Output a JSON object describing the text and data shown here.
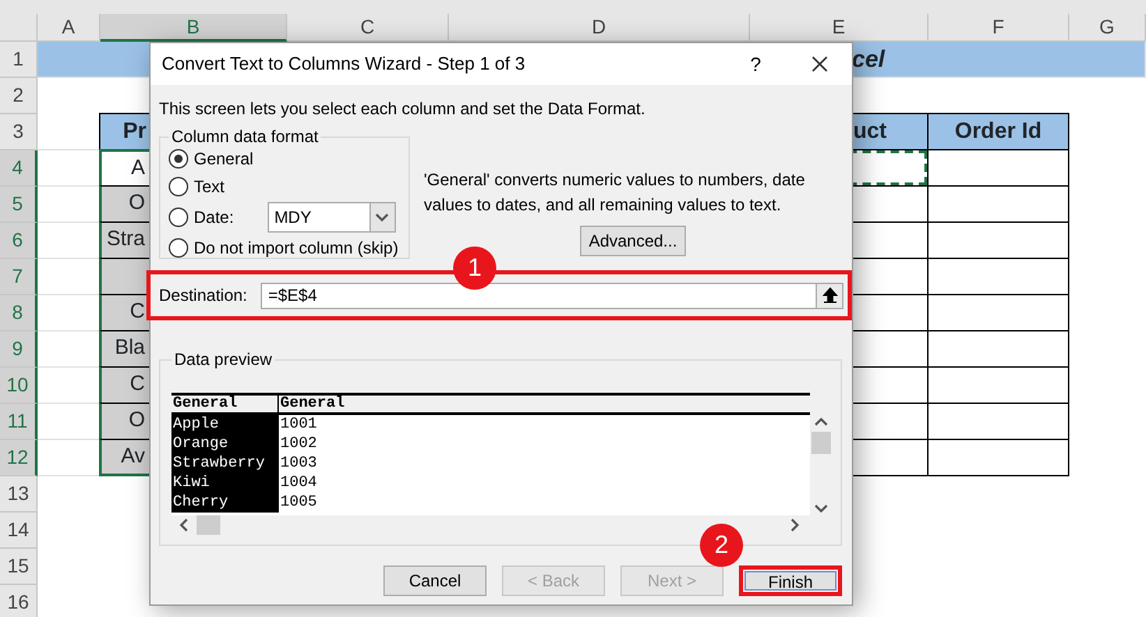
{
  "sheet": {
    "columns": [
      {
        "label": "A",
        "selected": false
      },
      {
        "label": "B",
        "selected": true
      },
      {
        "label": "C",
        "selected": false
      },
      {
        "label": "D",
        "selected": false
      },
      {
        "label": "E",
        "selected": false
      },
      {
        "label": "F",
        "selected": false
      },
      {
        "label": "G",
        "selected": false
      }
    ],
    "rows": [
      {
        "number": "1",
        "selected": false,
        "cells": [
          {
            "kind": "title",
            "text": "cel"
          }
        ]
      },
      {
        "number": "2",
        "selected": false,
        "cells": []
      },
      {
        "number": "3",
        "selected": false,
        "cells": [
          {
            "kind": "blank"
          },
          {
            "kind": "header",
            "text": "Pr"
          },
          {
            "kind": "header"
          },
          {
            "kind": "header"
          },
          {
            "kind": "header",
            "text": "uct"
          },
          {
            "kind": "header",
            "text": "Order Id"
          }
        ]
      },
      {
        "number": "4",
        "selected": true,
        "cells": [
          {
            "kind": "blank"
          },
          {
            "kind": "data",
            "text": "A",
            "selected": true,
            "active": true
          },
          {
            "kind": "data"
          },
          {
            "kind": "data"
          },
          {
            "kind": "data",
            "marquee": true
          },
          {
            "kind": "data"
          }
        ]
      },
      {
        "number": "5",
        "selected": true,
        "cells": [
          {
            "kind": "blank"
          },
          {
            "kind": "data",
            "text": "O",
            "selected": true
          },
          {
            "kind": "data"
          },
          {
            "kind": "data"
          },
          {
            "kind": "data"
          },
          {
            "kind": "data"
          }
        ]
      },
      {
        "number": "6",
        "selected": true,
        "cells": [
          {
            "kind": "blank"
          },
          {
            "kind": "data",
            "text": "Stra",
            "selected": true
          },
          {
            "kind": "data"
          },
          {
            "kind": "data"
          },
          {
            "kind": "data"
          },
          {
            "kind": "data"
          }
        ]
      },
      {
        "number": "7",
        "selected": true,
        "cells": [
          {
            "kind": "blank"
          },
          {
            "kind": "data",
            "selected": true
          },
          {
            "kind": "data"
          },
          {
            "kind": "data"
          },
          {
            "kind": "data"
          },
          {
            "kind": "data"
          }
        ]
      },
      {
        "number": "8",
        "selected": true,
        "cells": [
          {
            "kind": "blank"
          },
          {
            "kind": "data",
            "text": "C",
            "selected": true
          },
          {
            "kind": "data"
          },
          {
            "kind": "data"
          },
          {
            "kind": "data"
          },
          {
            "kind": "data"
          }
        ]
      },
      {
        "number": "9",
        "selected": true,
        "cells": [
          {
            "kind": "blank"
          },
          {
            "kind": "data",
            "text": "Bla",
            "selected": true
          },
          {
            "kind": "data"
          },
          {
            "kind": "data"
          },
          {
            "kind": "data"
          },
          {
            "kind": "data"
          }
        ]
      },
      {
        "number": "10",
        "selected": true,
        "cells": [
          {
            "kind": "blank"
          },
          {
            "kind": "data",
            "text": "C",
            "selected": true
          },
          {
            "kind": "data"
          },
          {
            "kind": "data"
          },
          {
            "kind": "data"
          },
          {
            "kind": "data"
          }
        ]
      },
      {
        "number": "11",
        "selected": true,
        "cells": [
          {
            "kind": "blank"
          },
          {
            "kind": "data",
            "text": "O",
            "selected": true
          },
          {
            "kind": "data"
          },
          {
            "kind": "data"
          },
          {
            "kind": "data"
          },
          {
            "kind": "data"
          }
        ]
      },
      {
        "number": "12",
        "selected": true,
        "cells": [
          {
            "kind": "blank"
          },
          {
            "kind": "data",
            "text": "Av",
            "selected": true
          },
          {
            "kind": "data"
          },
          {
            "kind": "data"
          },
          {
            "kind": "data"
          },
          {
            "kind": "data"
          }
        ]
      },
      {
        "number": "13",
        "selected": false,
        "cells": []
      },
      {
        "number": "14",
        "selected": false,
        "cells": []
      },
      {
        "number": "15",
        "selected": false,
        "cells": []
      },
      {
        "number": "16",
        "selected": false,
        "cells": []
      }
    ]
  },
  "dialog": {
    "title": "Convert Text to Columns Wizard - Step 1 of 3",
    "help": "?",
    "intro": "This screen lets you select each column and set the Data Format.",
    "format_group": {
      "title": "Column data format",
      "options": [
        {
          "kind": "plain",
          "label": "General",
          "selected": true
        },
        {
          "kind": "plain",
          "label": "Text",
          "selected": false
        },
        {
          "kind": "date",
          "label": "Date:",
          "selected": false,
          "dropdown": "MDY"
        },
        {
          "kind": "plain",
          "label": "Do not import column (skip)",
          "selected": false
        }
      ]
    },
    "description": "'General' converts numeric values to numbers, date values to dates, and all remaining values to text.",
    "advanced_button": "Advanced...",
    "destination": {
      "label": "Destination:",
      "value": "=$E$4",
      "highlighted": true
    },
    "preview": {
      "title": "Data preview",
      "columns": [
        {
          "header": "General",
          "selected": true
        },
        {
          "header": "General",
          "selected": false
        }
      ],
      "rows": [
        [
          "Apple",
          "1001"
        ],
        [
          "Orange",
          "1002"
        ],
        [
          "Strawberry",
          "1003"
        ],
        [
          "Kiwi",
          "1004"
        ],
        [
          "Cherry",
          "1005"
        ]
      ]
    },
    "buttons": [
      {
        "label": "Cancel",
        "disabled": false,
        "highlighted": false
      },
      {
        "label": "< Back",
        "disabled": true,
        "highlighted": false
      },
      {
        "label": "Next >",
        "disabled": true,
        "highlighted": false
      },
      {
        "label": "Finish",
        "disabled": false,
        "highlighted": true
      }
    ]
  },
  "callouts": [
    {
      "text": "1"
    },
    {
      "text": "2"
    }
  ]
}
